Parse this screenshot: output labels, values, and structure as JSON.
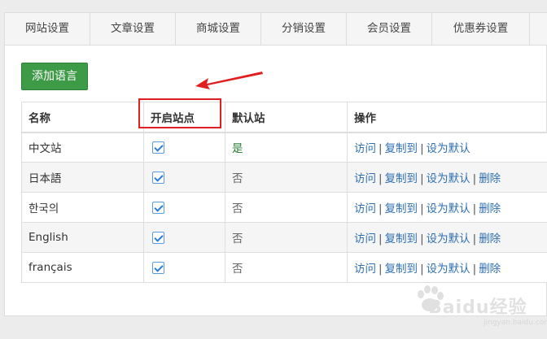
{
  "tabs": [
    "网站设置",
    "文章设置",
    "商城设置",
    "分销设置",
    "会员设置",
    "优惠券设置"
  ],
  "add_button_label": "添加语言",
  "table": {
    "headers": {
      "name": "名称",
      "enabled": "开启站点",
      "default": "默认站",
      "actions": "操作"
    },
    "rows": [
      {
        "name": "中文站",
        "enabled": true,
        "default": "是"
      },
      {
        "name": "日本語",
        "enabled": true,
        "default": "否"
      },
      {
        "name": "한국의",
        "enabled": true,
        "default": "否"
      },
      {
        "name": "English",
        "enabled": true,
        "default": "否"
      },
      {
        "name": "français",
        "enabled": true,
        "default": "否"
      }
    ],
    "action_labels": {
      "visit": "访问",
      "copy": "复制到",
      "set_default": "设为默认",
      "delete": "删除"
    }
  },
  "watermark": {
    "brand": "Baidu经验",
    "sub": "jingyan.baidu.com"
  },
  "colors": {
    "add_button": "#3d9a46",
    "link": "#2f6fb0",
    "default_yes": "#2e7d32",
    "annotation": "#e02020"
  }
}
